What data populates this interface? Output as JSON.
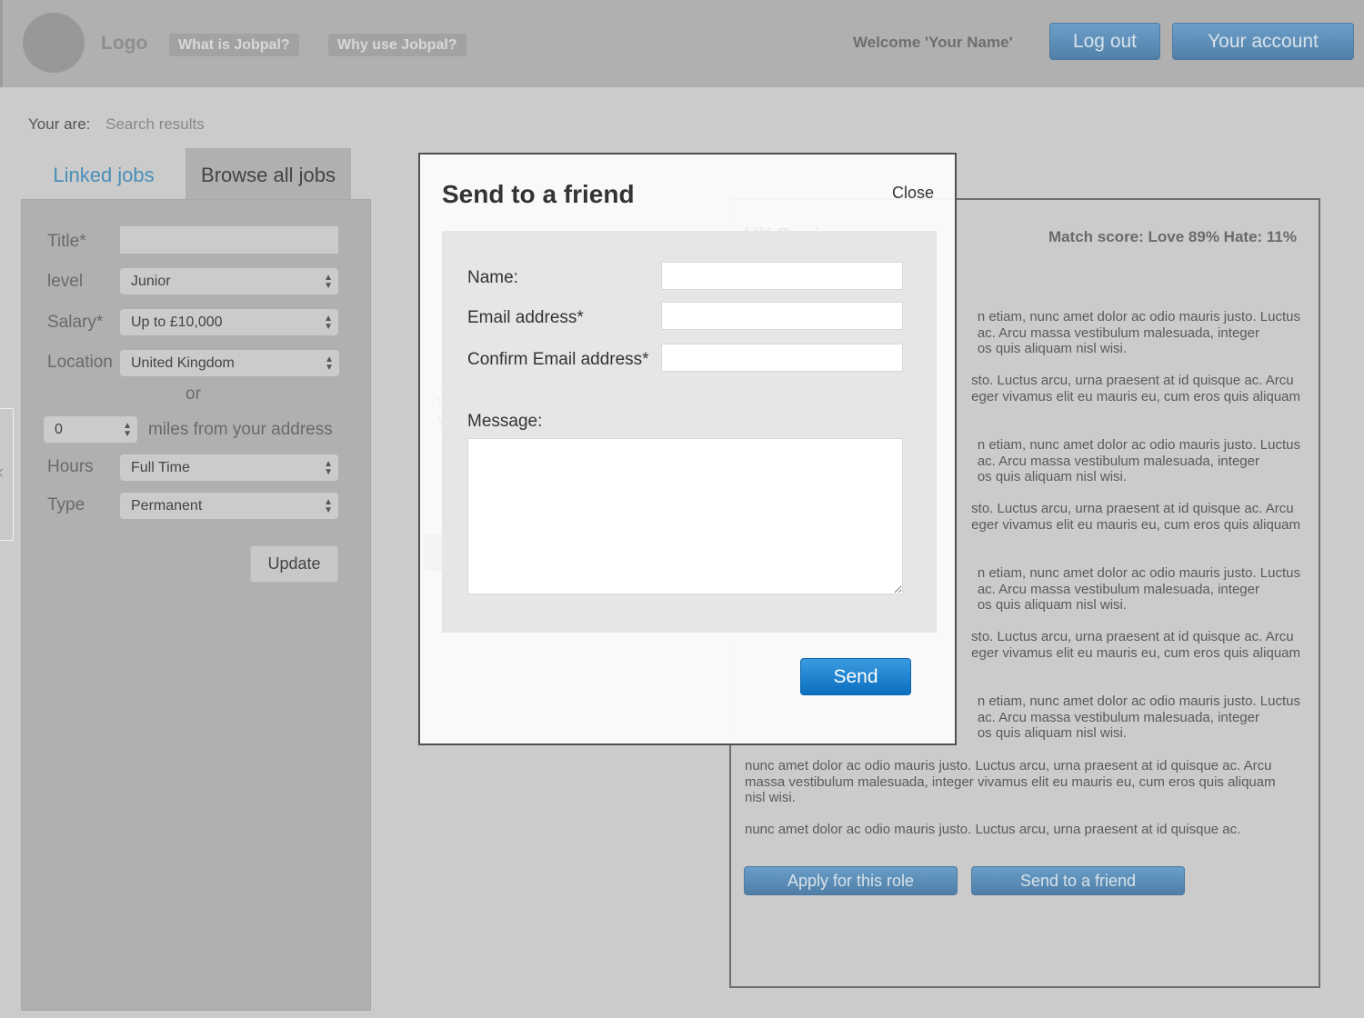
{
  "header": {
    "logo": "Logo",
    "nav": [
      "What is Jobpal?",
      "Why use Jobpal?"
    ],
    "welcome": "Welcome 'Your Name'",
    "logout": "Log out",
    "account": "Your account"
  },
  "breadcrumb": {
    "label": "Your are:",
    "value": "Search results"
  },
  "side_collapse_icon": "‹",
  "tabs": {
    "linked": "Linked jobs",
    "browse": "Browse all jobs"
  },
  "filters": {
    "title_label": "Title*",
    "title_value": "",
    "level_label": "level",
    "level_value": "Junior",
    "salary_label": "Salary*",
    "salary_value": "Up to £10,000",
    "location_label": "Location",
    "location_value": "United Kingdom",
    "or": "or",
    "miles_value": "0",
    "miles_label": "miles from your address",
    "hours_label": "Hours",
    "hours_value": "Full Time",
    "type_label": "Type",
    "type_value": "Permanent",
    "update": "Update"
  },
  "background_ghost": {
    "person_name": "James Fern",
    "person_sub": "Your connection",
    "job_title": "UX Designer"
  },
  "job": {
    "match_score": "Match score: Love 89% Hate: 11%",
    "paragraphs": [
      "n etiam, nunc amet dolor ac odio mauris justo. Luctus\nac. Arcu massa vestibulum malesuada, integer\nos quis aliquam nisl wisi.",
      "sto. Luctus arcu, urna praesent at id quisque ac. Arcu\neger vivamus elit eu mauris eu, cum eros quis aliquam",
      "n etiam, nunc amet dolor ac odio mauris justo. Luctus\nac. Arcu massa vestibulum malesuada, integer\nos quis aliquam nisl wisi.",
      "sto. Luctus arcu, urna praesent at id quisque ac. Arcu\neger vivamus elit eu mauris eu, cum eros quis aliquam",
      "n etiam, nunc amet dolor ac odio mauris justo. Luctus\nac. Arcu massa vestibulum malesuada, integer\nos quis aliquam nisl wisi.",
      "sto. Luctus arcu, urna praesent at id quisque ac. Arcu\neger vivamus elit eu mauris eu, cum eros quis aliquam",
      "n etiam, nunc amet dolor ac odio mauris justo. Luctus\nac. Arcu massa vestibulum malesuada, integer\nos quis aliquam nisl wisi.",
      "nunc amet dolor ac odio mauris justo. Luctus arcu, urna praesent at id quisque ac. Arcu\nmassa vestibulum malesuada, integer vivamus elit eu mauris eu, cum eros quis aliquam\nnisl wisi.",
      "nunc amet dolor ac odio mauris justo. Luctus arcu, urna praesent at id quisque ac."
    ],
    "apply": "Apply for this role",
    "send_friend": "Send to a friend"
  },
  "modal": {
    "title": "Send to a friend",
    "close": "Close",
    "name_label": "Name:",
    "name_value": "",
    "email_label": "Email address*",
    "email_value": "",
    "confirm_label": "Confirm Email address*",
    "confirm_value": "",
    "message_label": "Message:",
    "message_value": "",
    "send": "Send"
  }
}
